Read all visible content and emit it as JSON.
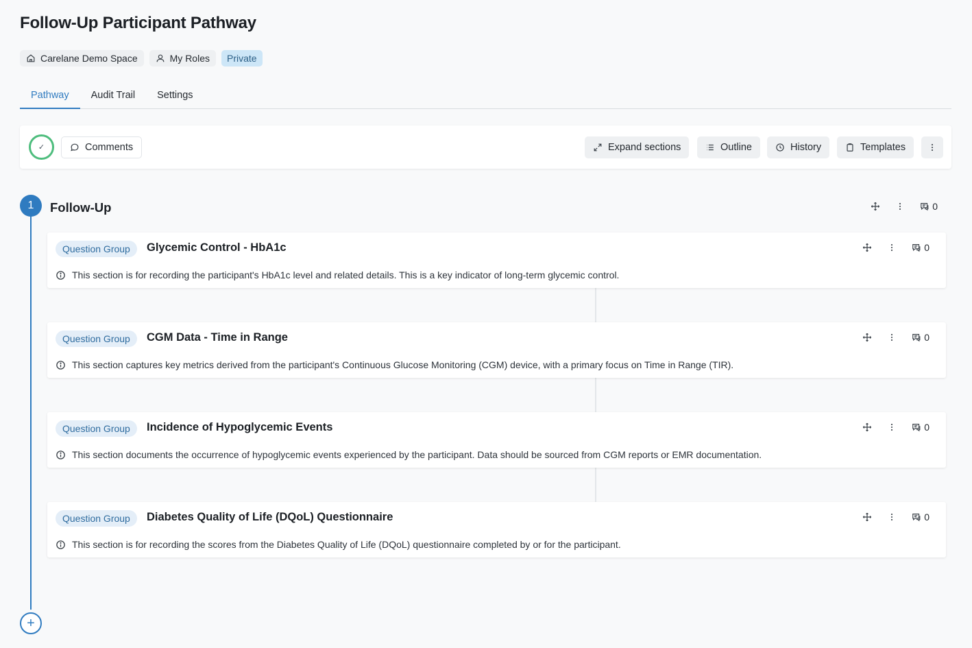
{
  "page": {
    "title": "Follow-Up Participant Pathway",
    "chips": [
      {
        "label": "Carelane Demo Space",
        "icon": "home-icon"
      },
      {
        "label": "My Roles",
        "icon": "user-icon"
      },
      {
        "label": "Private"
      }
    ]
  },
  "tabs": [
    {
      "label": "Pathway",
      "active": true
    },
    {
      "label": "Audit Trail",
      "active": false
    },
    {
      "label": "Settings",
      "active": false
    }
  ],
  "toolbar": {
    "status_glyph": "✓",
    "comments_label": "Comments",
    "expand_label": "Expand sections",
    "outline_label": "Outline",
    "history_label": "History",
    "templates_label": "Templates"
  },
  "section": {
    "number": "1",
    "title": "Follow-Up",
    "comment_count": "0"
  },
  "cards": [
    {
      "tag": "Question Group",
      "title": "Glycemic Control - HbA1c",
      "description": "This section is for recording the participant's HbA1c level and related details. This is a key indicator of long-term glycemic control.",
      "comment_count": "0"
    },
    {
      "tag": "Question Group",
      "title": "CGM Data - Time in Range",
      "description": "This section captures key metrics derived from the participant's Continuous Glucose Monitoring (CGM) device, with a primary focus on Time in Range (TIR).",
      "comment_count": "0"
    },
    {
      "tag": "Question Group",
      "title": "Incidence of Hypoglycemic Events",
      "description": "This section documents the occurrence of hypoglycemic events experienced by the participant. Data should be sourced from CGM reports or EMR documentation.",
      "comment_count": "0"
    },
    {
      "tag": "Question Group",
      "title": "Diabetes Quality of Life (DQoL) Questionnaire",
      "description": "This section is for recording the scores from the Diabetes Quality of Life (DQoL) questionnaire completed by or for the participant.",
      "comment_count": "0"
    }
  ],
  "add_glyph": "+",
  "colors": {
    "accent": "#2f7bc0",
    "status_ring": "#4ebd7d",
    "private_chip": "#cde6f7",
    "tag_bg": "#e4eef8"
  }
}
